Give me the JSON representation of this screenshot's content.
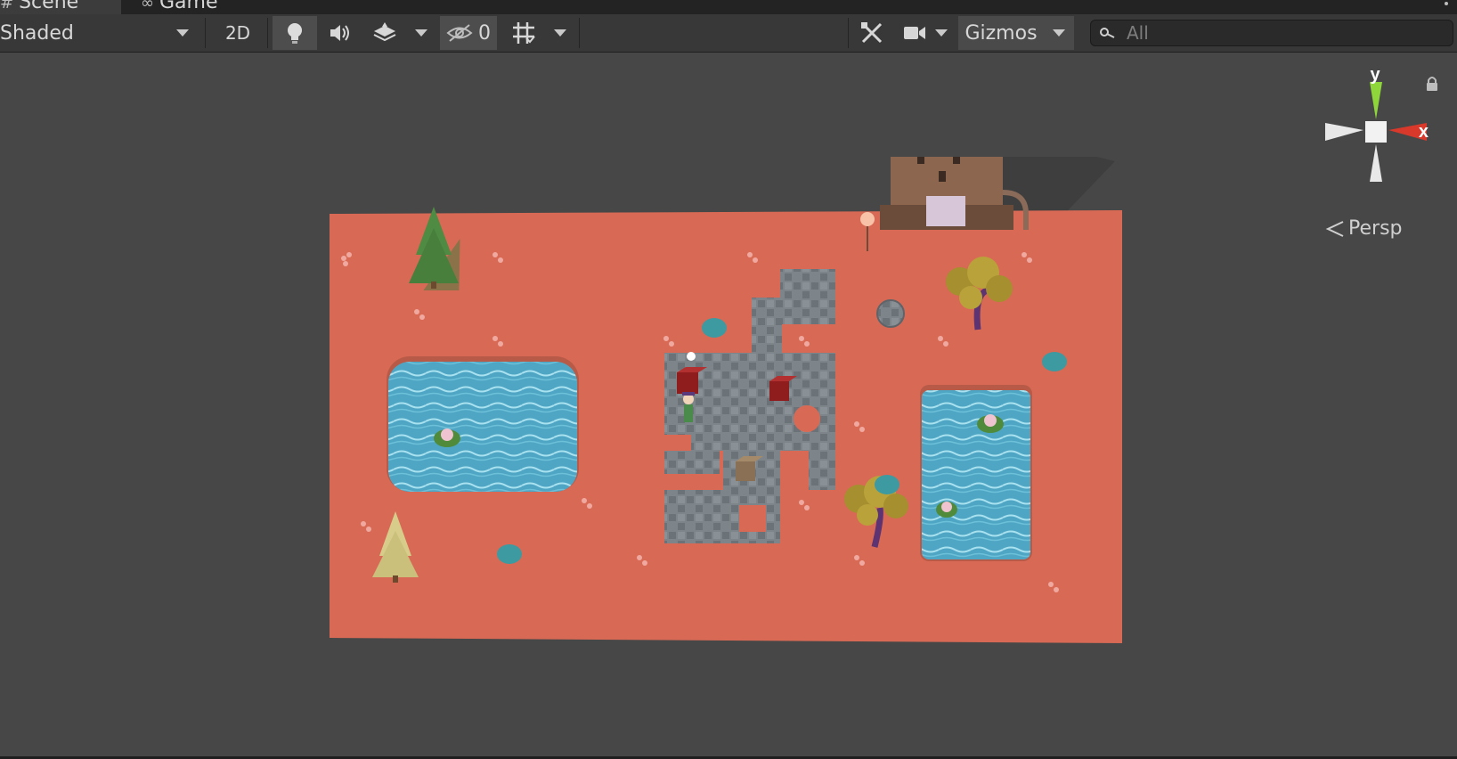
{
  "tabs": {
    "scene_icon": "#",
    "scene_label": "Scene",
    "game_icon": "∞",
    "game_label": "Game"
  },
  "toolbar": {
    "draw_mode": "Shaded",
    "mode_2d": "2D",
    "hidden_count": "0",
    "gizmos": "Gizmos",
    "search_placeholder": "All"
  },
  "axis_gizmo": {
    "y_label": "y",
    "x_label": "x",
    "projection": "Persp",
    "colors": {
      "y": "#8fd63a",
      "x": "#d8392b",
      "neutral": "#e8e8e8"
    }
  },
  "icons": [
    "hash-icon",
    "game-controller-icon",
    "kebab-menu-icon",
    "dropdown-arrow-icon",
    "lightbulb-icon",
    "audio-icon",
    "effects-layers-icon",
    "hidden-eye-icon",
    "grid-icon",
    "tools-icon",
    "camera-icon",
    "search-icon",
    "lock-icon",
    "perspective-chevron-icon"
  ],
  "colors": {
    "viewport_bg": "#474747",
    "toolbar_bg": "#383838",
    "ground": "#d86a55",
    "water": "#4fa6c4",
    "stone": "#7e858a"
  }
}
